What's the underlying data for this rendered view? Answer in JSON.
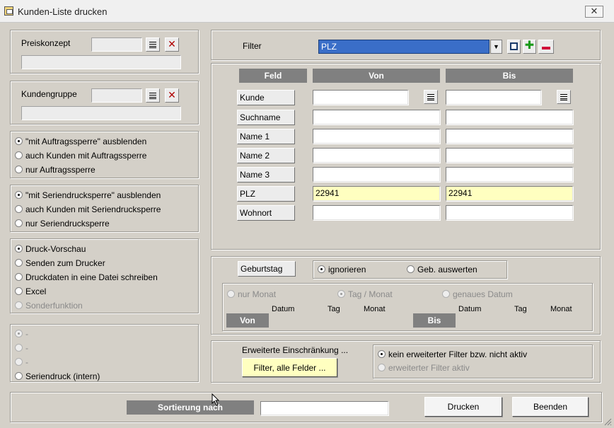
{
  "window": {
    "title": "Kunden-Liste drucken",
    "close": "☒"
  },
  "preiskonzept": {
    "label": "Preiskonzept",
    "code": "",
    "desc": ""
  },
  "kundengruppe": {
    "label": "Kundengruppe",
    "code": "",
    "desc": ""
  },
  "auftragssperre": {
    "options": [
      "\"mit Auftragssperre\" ausblenden",
      "auch Kunden mit Auftragssperre",
      "nur Auftragssperre"
    ],
    "selected": 0
  },
  "seriendrucksperre": {
    "options": [
      "\"mit Seriendrucksperre\" ausblenden",
      "auch Kunden mit Seriendrucksperre",
      "nur Seriendrucksperre"
    ],
    "selected": 0
  },
  "ausgabe": {
    "options": [
      "Druck-Vorschau",
      "Senden zum Drucker",
      "Druckdaten in eine Datei schreiben",
      "Excel",
      "Sonderfunktion"
    ],
    "selected": 0
  },
  "extra": {
    "options": [
      "-",
      "-",
      "-",
      "Seriendruck (intern)"
    ],
    "selected": 0
  },
  "filter": {
    "label": "Filter",
    "selected": "PLZ"
  },
  "grid": {
    "headers": {
      "feld": "Feld",
      "von": "Von",
      "bis": "Bis"
    },
    "rows": [
      {
        "field": "Kunde",
        "von": "",
        "bis": ""
      },
      {
        "field": "Suchname",
        "von": "",
        "bis": ""
      },
      {
        "field": "Name 1",
        "von": "",
        "bis": ""
      },
      {
        "field": "Name 2",
        "von": "",
        "bis": ""
      },
      {
        "field": "Name 3",
        "von": "",
        "bis": ""
      },
      {
        "field": "PLZ",
        "von": "22941",
        "bis": "22941"
      },
      {
        "field": "Wohnort",
        "von": "",
        "bis": ""
      }
    ]
  },
  "geburtstag": {
    "label": "Geburtstag",
    "ignorieren": "ignorieren",
    "auswerten": "Geb. auswerten",
    "mode_monat": "nur Monat",
    "mode_tagmonat": "Tag / Monat",
    "mode_datum": "genaues Datum",
    "von": "Von",
    "bis": "Bis",
    "col_datum": "Datum",
    "col_tag": "Tag",
    "col_monat": "Monat"
  },
  "erweitert": {
    "label": "Erweiterte Einschränkung ...",
    "button": "Filter, alle Felder ...",
    "opt_off": "kein erweiterter Filter bzw. nicht aktiv",
    "opt_on": "erweiterter Filter aktiv"
  },
  "bottom": {
    "sort_label": "Sortierung nach",
    "sort_value": "",
    "print": "Drucken",
    "close": "Beenden"
  },
  "colors": {
    "header": "#808080",
    "highlight": "#ffffc0",
    "selection": "#3a6ec8"
  }
}
